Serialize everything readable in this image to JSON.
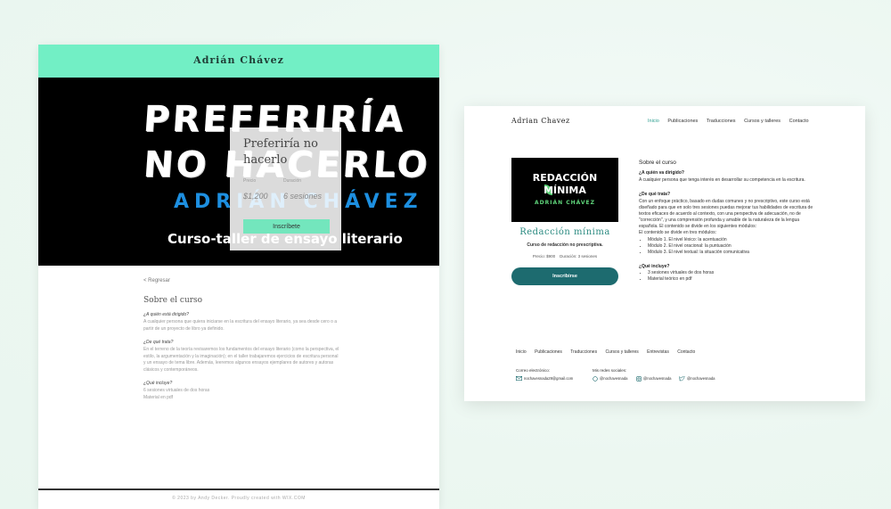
{
  "left_site": {
    "brand": "Adrián Chávez",
    "hero": {
      "line1": "PREFERIRÍA",
      "line2": "NO HACERLO",
      "author": "ADRIÁN CHÁVEZ",
      "subtitle": "Curso-taller de ensayo literario"
    },
    "card": {
      "title": "Preferiría no hacerlo",
      "price_label": "Precio",
      "duration_label": "Duración",
      "price_value": "$1,200",
      "duration_value": "6 sesiones",
      "button": "Inscríbete"
    },
    "back_link": "< Regresar",
    "section_title": "Sobre el curso",
    "q1": "¿A quién está dirigido?",
    "a1": "A cualquier persona que quiera iniciarse en la escritura del ensayo literario, ya sea desde cero o a partir de un proyecto de libro ya definido.",
    "q2": "¿De qué trata?",
    "a2": "En el terreno de la teoría revisaremos los fundamentos del ensayo literario (como la perspectiva, el estilo, la argumentación y la imaginación); en el taller trabajaremos ejercicios de escritura personal y un ensayo de tema libre. Además, leeremos algunos ensayos ejemplares de autores y autoras clásicos y contemporáneos.",
    "q3": "¿Qué incluye?",
    "inc1": "6 sesiones virtuales de dos horas",
    "inc2": "Material en pdf",
    "footer": "© 2023 by Andy Decker. Proudly created with WIX.COM"
  },
  "right_site": {
    "brand": "Adrian Chavez",
    "nav": [
      "Inicio",
      "Publicaciones",
      "Traducciones",
      "Cursos y talleres",
      "Contacto"
    ],
    "image": {
      "line1": "REDACCIÓN",
      "line2": "MÍNIMA",
      "author": "ADRIÁN CHÁVEZ"
    },
    "course_title": "Redacción mínima",
    "course_subtitle": "Curso de redacción no prescriptiva.",
    "price": "Precio: $900",
    "duration": "Duración: 3 sesiones",
    "button": "Inscribirse",
    "about_title": "Sobre el curso",
    "q1": "¿A quién va dirigido?",
    "a1": "A cualquier persona que tenga interés en desarrollar su competencia en la escritura.",
    "q2": "¿De qué trata?",
    "a2": "Con un enfoque práctico, basado en dudas comunes y no prescriptivo, este curso está diseñado para que en solo tres sesiones puedas mejorar tus habilidades de escritura de textos eficaces de acuerdo al contexto, con una perspectiva de adecuación, no de \"corrección\", y una comprensión profunda y amable de la naturaleza de la lengua española. El contenido se divide en los siguientes módulos:",
    "a2b": "El contenido se divide en tres módulos:",
    "modules": [
      "Módulo 1. El nivel léxico: la acentuación",
      "Módulo 2. El nivel oracional: la puntuación",
      "Módulo 3. El nivel textual: la situación comunicativa"
    ],
    "q3": "¿Qué incluye?",
    "includes": [
      "3 sesiones virtuales de dos horas",
      "Material teórico en pdf"
    ],
    "footer_nav": [
      "Inicio",
      "Publicaciones",
      "Traducciones",
      "Cursos y talleres",
      "Entrevistas",
      "Contacto"
    ],
    "email_label": "Correo electrónico:",
    "email": "nochavesnada29@gmail.com",
    "social_label": "Mis redes sociales:",
    "social": [
      "@nochavesnada",
      "@nochavesnada",
      "@nochavesnada"
    ]
  },
  "colors": {
    "mint": "#72efc5",
    "teal_button": "#1d6b6f",
    "teal_text": "#2a8a80",
    "hero_blue": "#1d8fe0",
    "leaf_green": "#5fd47a"
  }
}
